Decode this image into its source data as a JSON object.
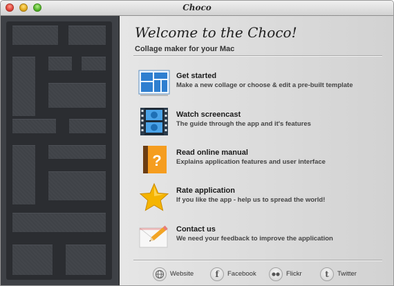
{
  "window": {
    "title": "Choco"
  },
  "main": {
    "welcome": "Welcome to the Choco!",
    "subtitle": "Collage maker for your Mac"
  },
  "items": [
    {
      "title": "Get started",
      "desc": "Make a new collage or choose & edit  a  pre-built template",
      "icon": "layout-grid-icon"
    },
    {
      "title": "Watch screencast",
      "desc": "The guide through the app and it's features",
      "icon": "film-strip-icon"
    },
    {
      "title": "Read online manual",
      "desc": "Explains application features and user interface",
      "icon": "manual-book-icon"
    },
    {
      "title": "Rate application",
      "desc": "If you like the app - help us to spread the world!",
      "icon": "star-icon"
    },
    {
      "title": "Contact us",
      "desc": "We need your feedback to improve the application",
      "icon": "envelope-pencil-icon"
    }
  ],
  "footer": [
    {
      "label": "Website",
      "icon": "globe-icon"
    },
    {
      "label": "Facebook",
      "icon": "facebook-icon"
    },
    {
      "label": "Flickr",
      "icon": "flickr-icon"
    },
    {
      "label": "Twitter",
      "icon": "twitter-icon"
    }
  ],
  "colors": {
    "sidebar": "#3e4146",
    "tile": "#43464b",
    "accent_blue": "#2f7fd0",
    "star": "#f5b400"
  }
}
